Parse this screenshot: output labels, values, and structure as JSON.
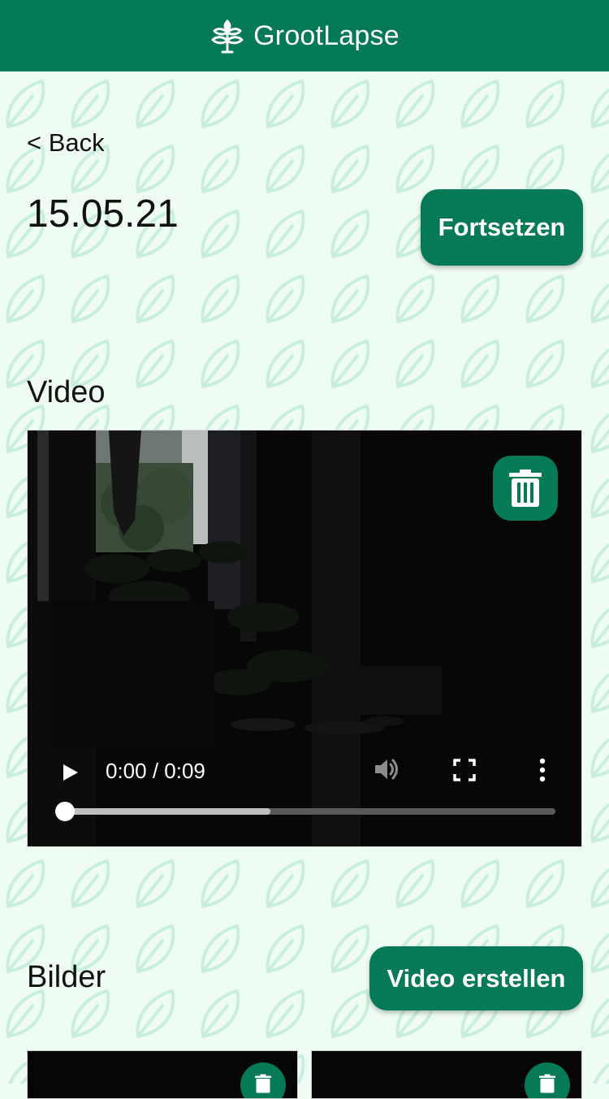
{
  "header": {
    "app_name": "GrootLapse",
    "logo_icon": "tree-icon",
    "background": "#037956"
  },
  "nav": {
    "back_label": "< Back"
  },
  "page": {
    "title": "15.05.21",
    "continue_label": "Fortsetzen"
  },
  "video_section": {
    "title": "Video",
    "player": {
      "time_display": "0:00 / 0:09",
      "progress": 0.0,
      "buffered": 0.42,
      "muted": true,
      "icons": [
        "play-icon",
        "volume-icon",
        "fullscreen-icon",
        "more-vert-icon",
        "trash-icon"
      ]
    }
  },
  "images_section": {
    "title": "Bilder",
    "create_video_label": "Video erstellen",
    "thumbnails": [
      {
        "icon": "trash-icon"
      },
      {
        "icon": "trash-icon"
      }
    ]
  },
  "colors": {
    "accent": "#067a57",
    "background": "#effcf4",
    "leaf_pattern": "#c8efd9"
  }
}
